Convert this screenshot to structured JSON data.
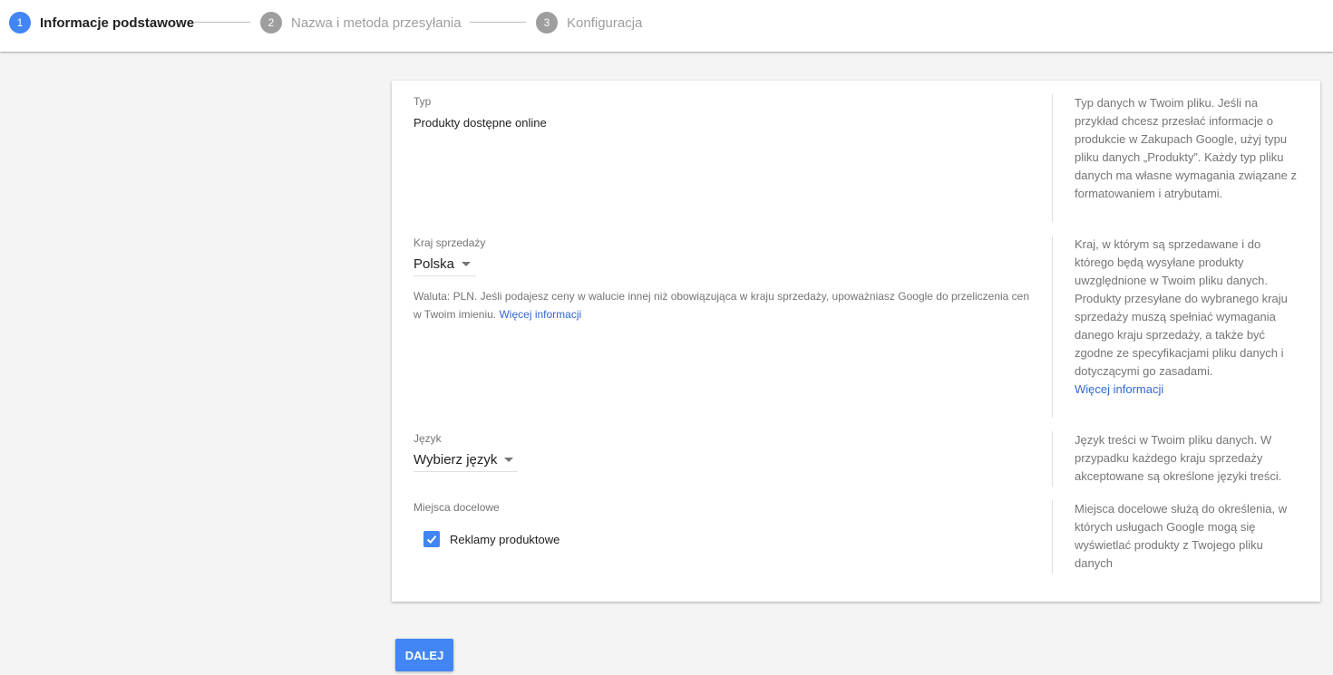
{
  "stepper": {
    "steps": [
      {
        "num": "1",
        "label": "Informacje podstawowe",
        "active": true
      },
      {
        "num": "2",
        "label": "Nazwa i metoda przesyłania",
        "active": false
      },
      {
        "num": "3",
        "label": "Konfiguracja",
        "active": false
      }
    ]
  },
  "form": {
    "type": {
      "label": "Typ",
      "value": "Produkty dostępne online",
      "help": "Typ danych w Twoim pliku. Jeśli na przykład chcesz przesłać informacje o produkcie w Zakupach Google, użyj typu pliku danych „Produkty”. Każdy typ pliku danych ma własne wymagania związane z formatowaniem i atrybutami."
    },
    "country": {
      "label": "Kraj sprzedaży",
      "value": "Polska",
      "note": "Waluta: PLN. Jeśli podajesz ceny w walucie innej niż obowiązująca w kraju sprzedaży, upoważniasz Google do przeliczenia cen w Twoim imieniu.",
      "note_link": "Więcej informacji",
      "help": "Kraj, w którym są sprzedawane i do którego będą wysyłane produkty uwzględnione w Twoim pliku danych. Produkty przesyłane do wybranego kraju sprzedaży muszą spełniać wymagania danego kraju sprzedaży, a także być zgodne ze specyfikacjami pliku danych i dotyczącymi go zasadami.",
      "help_link": "Więcej informacji"
    },
    "language": {
      "label": "Język",
      "value": "Wybierz język",
      "help": "Język treści w Twoim pliku danych. W przypadku każdego kraju sprzedaży akceptowane są określone języki treści."
    },
    "destinations": {
      "label": "Miejsca docelowe",
      "checkbox_label": "Reklamy produktowe",
      "checked": true,
      "help": "Miejsca docelowe służą do określenia, w których usługach Google mogą się wyświetlać produkty z Twojego pliku danych"
    }
  },
  "actions": {
    "next_label": "DALEJ"
  },
  "colors": {
    "accent": "#4285f4",
    "link": "#3367d6"
  }
}
